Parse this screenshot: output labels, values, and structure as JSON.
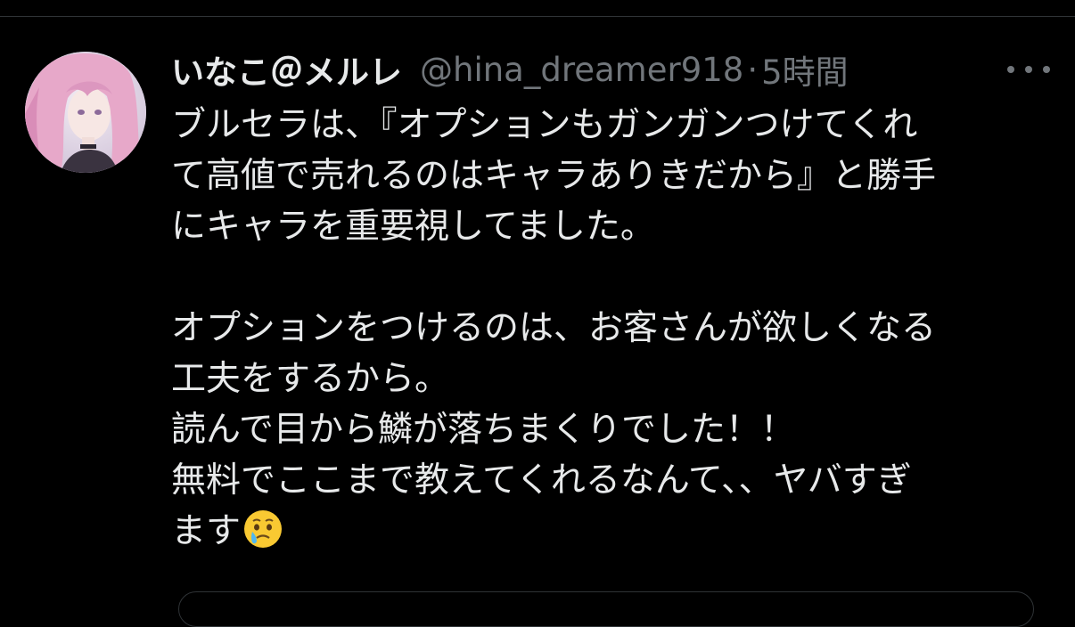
{
  "tweet": {
    "author": {
      "display_name": "いなこ＠メルレ",
      "handle": "@hina_dreamer918",
      "avatar_icon": "avatar-image"
    },
    "separator": "·",
    "timestamp": "5時間",
    "more_icon": "more-horizontal-icon",
    "body": {
      "lines": [
        "ブルセラは、『オプションもガンガンつけてくれ",
        "て高値で売れるのはキャラありきだから』と勝手",
        "にキャラを重要視してました。",
        "",
        "オプションをつけるのは、お客さんが欲しくなる",
        "工夫をするから。",
        "読んで目から鱗が落ちまくりでした！！",
        "無料でここまで教えてくれるなんて、、ヤバすぎ",
        "ます"
      ],
      "trailing_emoji": "face-holding-back-tears-emoji"
    }
  },
  "colors": {
    "background": "#000000",
    "primary_text": "#e7e9ea",
    "secondary_text": "#71767b",
    "divider": "#2f3336"
  }
}
